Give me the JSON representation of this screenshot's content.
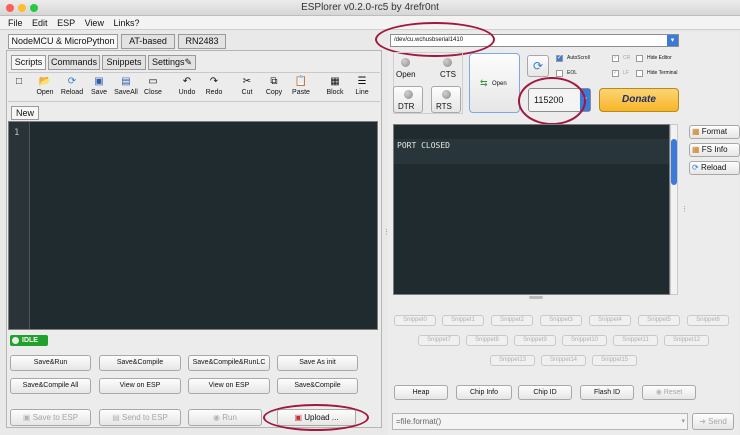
{
  "window": {
    "title": "ESPlorer v0.2.0-rc5 by 4refr0nt"
  },
  "menu": [
    "File",
    "Edit",
    "ESP",
    "View",
    "Links?"
  ],
  "left": {
    "device_tabs": [
      "NodeMCU & MicroPython",
      "AT-based",
      "RN2483"
    ],
    "sub_tabs": [
      "Scripts",
      "Commands",
      "Snippets",
      "Settings"
    ],
    "toolbar": [
      {
        "label": "",
        "icon": "new-file-icon",
        "glyph": "□"
      },
      {
        "label": "Open",
        "icon": "folder-icon",
        "glyph": "📂"
      },
      {
        "label": "Reload",
        "icon": "reload-icon",
        "glyph": "⟳"
      },
      {
        "label": "Save",
        "icon": "save-icon",
        "glyph": "▣"
      },
      {
        "label": "SaveAll",
        "icon": "save-all-icon",
        "glyph": "▤"
      },
      {
        "label": "Close",
        "icon": "close-file-icon",
        "glyph": "▭"
      },
      {
        "label": "Undo",
        "icon": "undo-icon",
        "glyph": "↶"
      },
      {
        "label": "Redo",
        "icon": "redo-icon",
        "glyph": "↷"
      },
      {
        "label": "Cut",
        "icon": "scissors-icon",
        "glyph": "✂"
      },
      {
        "label": "Copy",
        "icon": "copy-icon",
        "glyph": "⧉"
      },
      {
        "label": "Paste",
        "icon": "paste-icon",
        "glyph": "📋"
      },
      {
        "label": "Block",
        "icon": "block-icon",
        "glyph": "▦"
      },
      {
        "label": "Line",
        "icon": "line-icon",
        "glyph": "☰"
      }
    ],
    "file_tab": "New",
    "line_number": "1",
    "status": "IDLE",
    "buttons_row1": [
      "Save&Run",
      "Save&Compile",
      "Save&Compile&RunLC",
      "Save As init"
    ],
    "buttons_row2": [
      "Save&Compile All",
      "View on ESP",
      "View on ESP",
      "Save&Compile"
    ],
    "bottom": {
      "save_to_esp": "Save to ESP",
      "send_to_esp": "Send to ESP",
      "run": "Run",
      "upload": "Upload ..."
    }
  },
  "right": {
    "port": "/dev/cu.wchusbserial1410",
    "open_led": "Open",
    "cts": "CTS",
    "dtr": "DTR",
    "rts": "RTS",
    "open_button": "Open",
    "baud": "115200",
    "donate": "Donate",
    "checks": [
      {
        "label": "AutoScroll",
        "checked": true
      },
      {
        "label": "EOL",
        "checked": false
      },
      {
        "label": "CR",
        "checked": true
      },
      {
        "label": "LF",
        "checked": true
      },
      {
        "label": "Hide Editor",
        "checked": false
      },
      {
        "label": "Hide Terminal",
        "checked": false
      }
    ],
    "terminal": "PORT CLOSED",
    "side_buttons": [
      "Format",
      "FS Info",
      "Reload"
    ],
    "snippets": [
      "Snippet0",
      "Snippet1",
      "Snippet2",
      "Snippet3",
      "Snippet4",
      "Snippet5",
      "Snippet6",
      "Snippet7",
      "Snippet8",
      "Snippet9",
      "Snippet10",
      "Snippet11",
      "Snippet12",
      "Snippet13",
      "Snippet14",
      "Snippet15"
    ],
    "bottom_buttons": [
      "Heap",
      "Chip Info",
      "Chip ID",
      "Flash ID",
      "Reset"
    ],
    "command_input": "=file.format()",
    "send": "Send"
  },
  "colors": {
    "editor_bg": "#1f2b2f",
    "highlight": "#a1173d",
    "status_green": "#21a12c",
    "donate": "#f7b528"
  }
}
